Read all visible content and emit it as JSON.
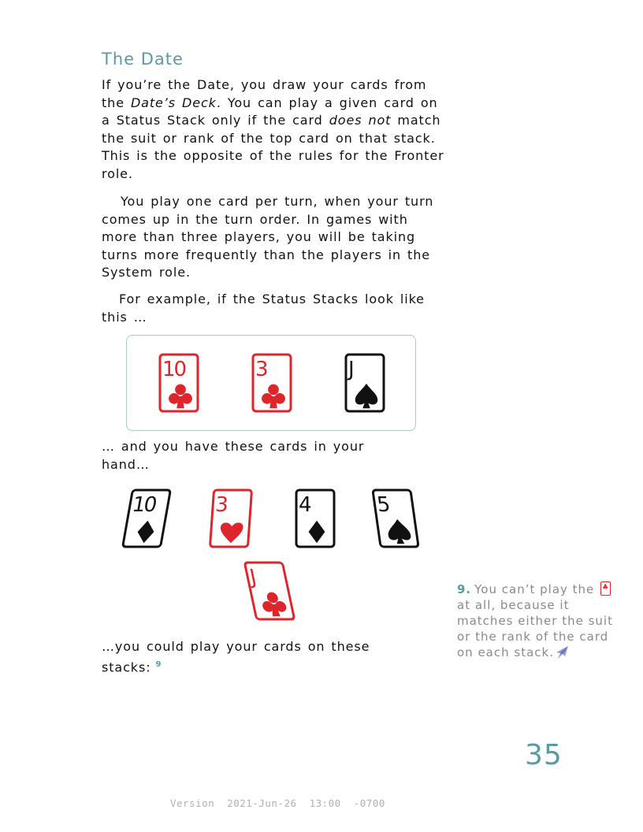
{
  "heading": "The Date",
  "p1": {
    "a": "If you’re the Date, you draw your cards from the ",
    "deck": "Date’s Deck",
    "b": ". You can play a given card on a Status Stack only if the card ",
    "not": "does not",
    "c": " match the suit or rank of the top card on that stack. This is the opposite of the rules for the Fronter role."
  },
  "p2": "You play one card per turn, when your turn comes up in the turn order. In games with more than three players, you will be taking turns more frequently than the players in the System role.",
  "p3": "For example, if the Status Stacks look like this …",
  "p4": "… and you have these cards in your hand…",
  "p5": "…you could play your cards on these stacks:",
  "fnref": "9",
  "colors": {
    "red": "#e0242b",
    "black": "#111111",
    "accent": "#5a9aa3"
  },
  "stacks": [
    {
      "rank": "10",
      "suit": "club",
      "color": "red"
    },
    {
      "rank": "3",
      "suit": "club",
      "color": "red"
    },
    {
      "rank": "J",
      "suit": "spade",
      "color": "black"
    }
  ],
  "hand": [
    {
      "rank": "10",
      "suit": "diamond",
      "color": "black"
    },
    {
      "rank": "3",
      "suit": "heart",
      "color": "red"
    },
    {
      "rank": "4",
      "suit": "diamond",
      "color": "black"
    },
    {
      "rank": "5",
      "suit": "spade",
      "color": "black"
    },
    {
      "rank": "J",
      "suit": "club",
      "color": "red"
    }
  ],
  "footnote": {
    "num": "9.",
    "a": "You can’t play the",
    "b": "at all, because it matches either the suit or the rank of the card on each stack.",
    "end_icon": "bird-icon"
  },
  "page_number": "35",
  "version": "Version  2021-Jun-26  13:00  -0700"
}
